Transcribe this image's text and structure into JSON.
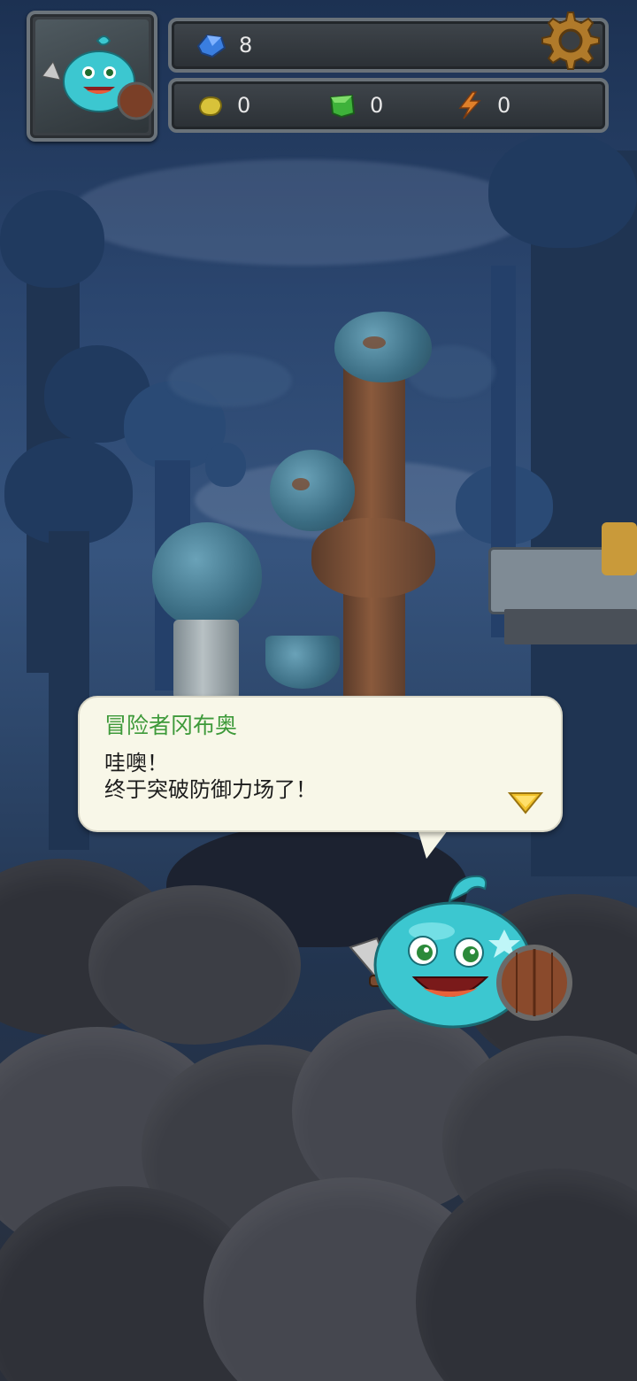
{
  "hud": {
    "gems": "8",
    "gold": "0",
    "green_crystal": "0",
    "energy": "0",
    "icons": {
      "gems": "blue-gem-icon",
      "gold": "gold-nugget-icon",
      "green_crystal": "green-crystal-icon",
      "energy": "lightning-icon",
      "settings": "gear-icon"
    }
  },
  "dialog": {
    "speaker": "冒险者冈布奥",
    "line1": "哇噢！",
    "line2": "终于突破防御力场了！"
  },
  "colors": {
    "speaker_name": "#3e9a3a",
    "dialog_bg": "#f8f7e8",
    "slime": "#3cc7d0"
  }
}
